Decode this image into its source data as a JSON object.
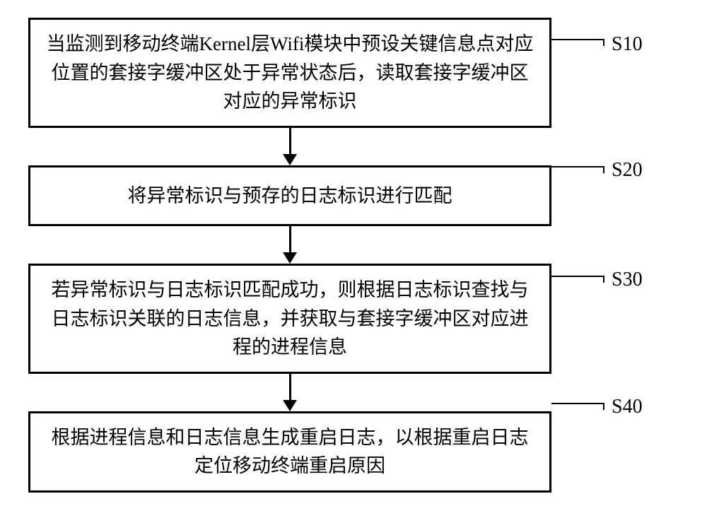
{
  "steps": [
    {
      "id": "s10",
      "label": "S10",
      "text": "当监测到移动终端Kernel层Wifi模块中预设关键信息点对应位置的套接字缓冲区处于异常状态后，读取套接字缓冲区对应的异常标识"
    },
    {
      "id": "s20",
      "label": "S20",
      "text": "将异常标识与预存的日志标识进行匹配"
    },
    {
      "id": "s30",
      "label": "S30",
      "text": "若异常标识与日志标识匹配成功，则根据日志标识查找与日志标识关联的日志信息，并获取与套接字缓冲区对应进程的进程信息"
    },
    {
      "id": "s40",
      "label": "S40",
      "text": "根据进程信息和日志信息生成重启日志，以根据重启日志定位移动终端重启原因"
    }
  ]
}
